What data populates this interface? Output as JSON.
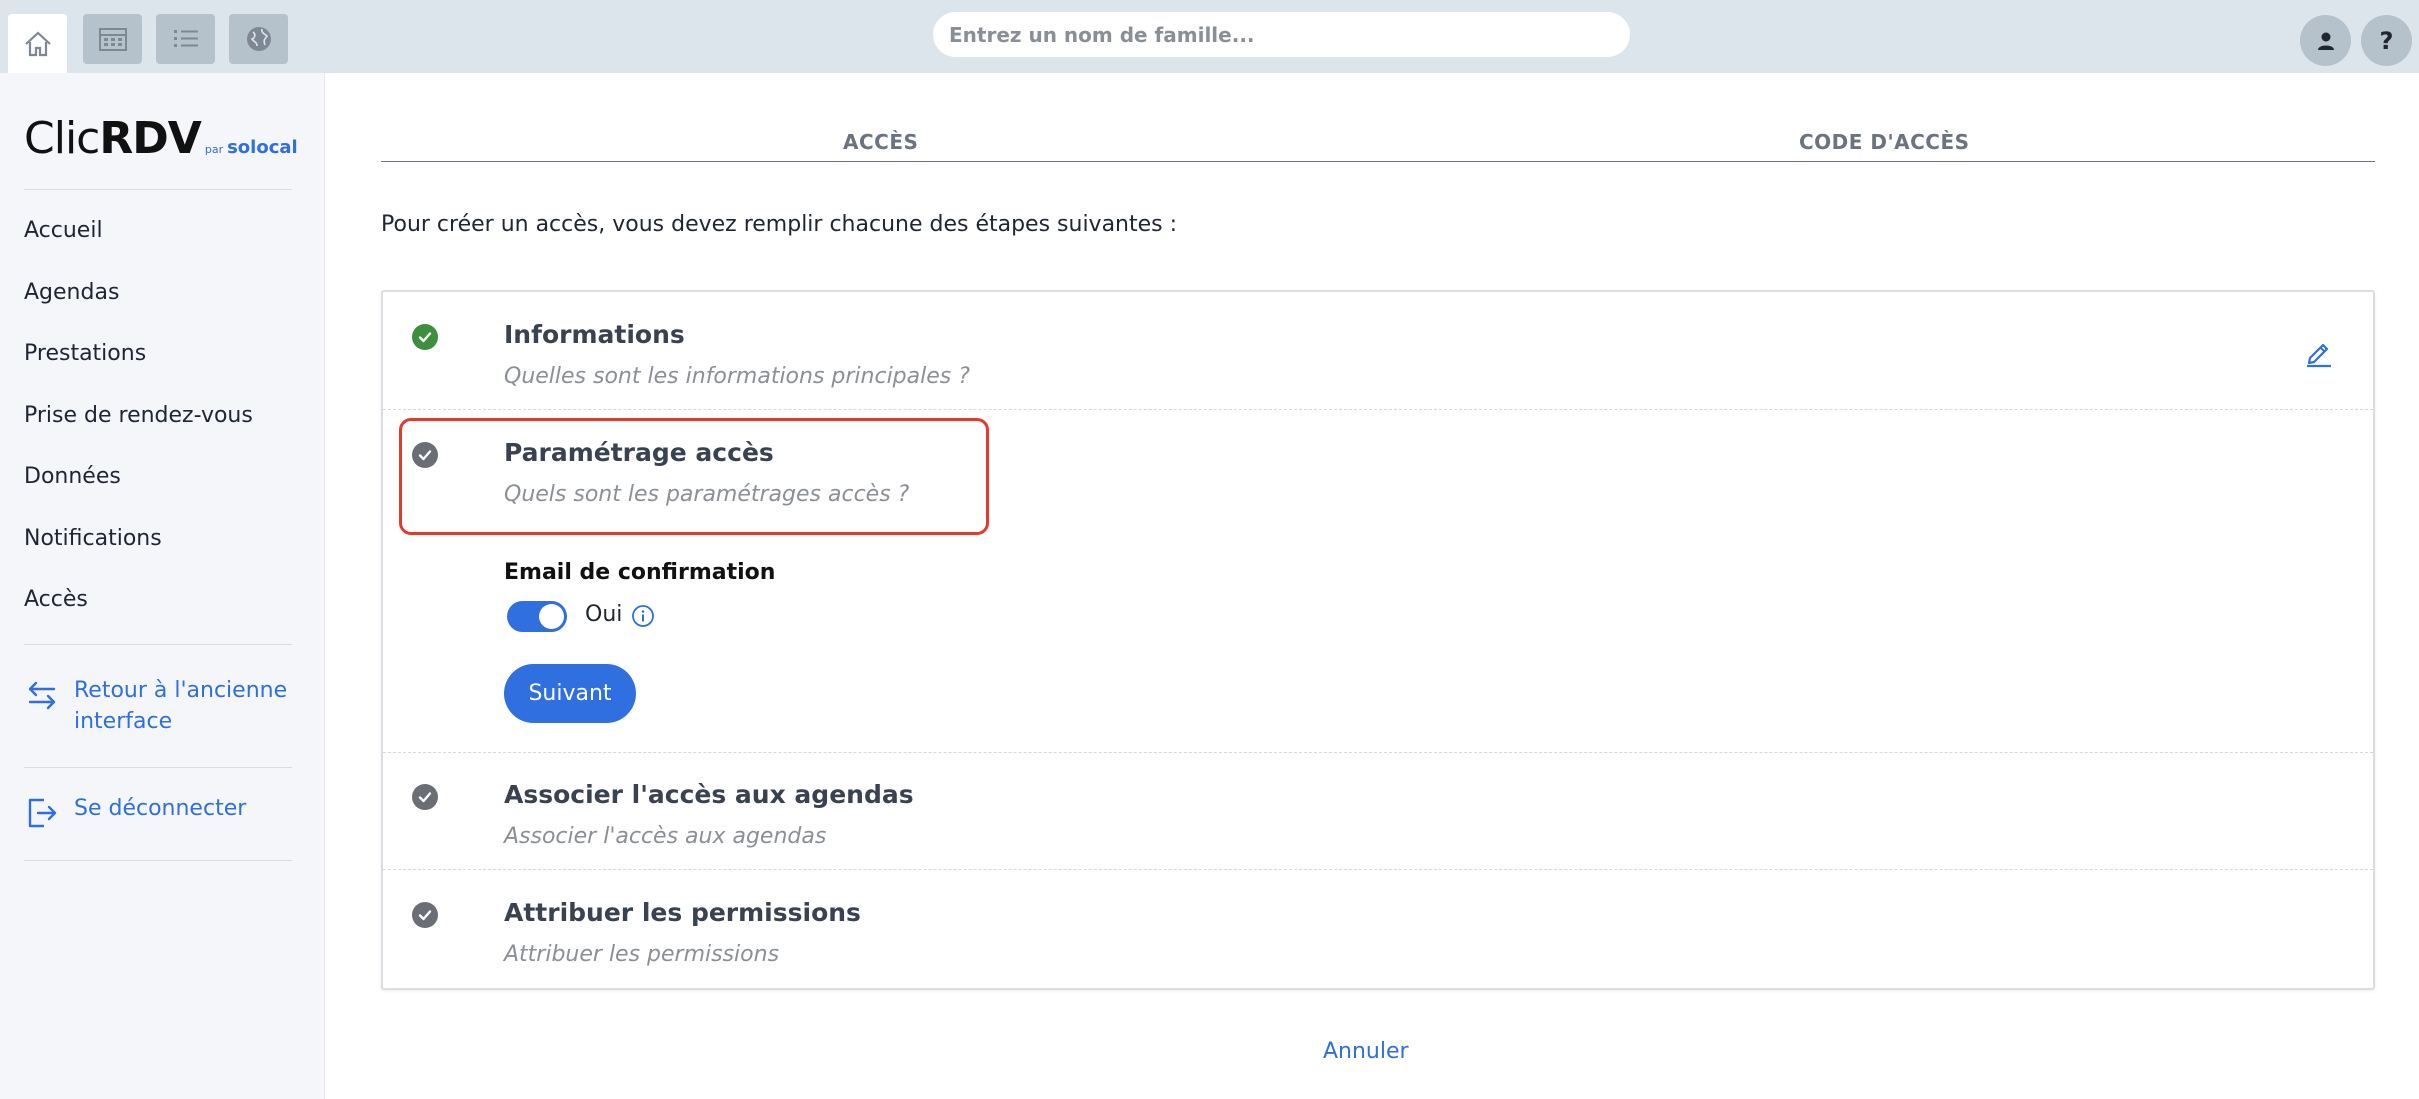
{
  "topbar": {
    "search_placeholder": "Entrez un nom de famille...",
    "help_label": "?"
  },
  "sidebar": {
    "logo": {
      "clic": "Clic",
      "rdv": "RDV",
      "par": "par",
      "brand": "solocal"
    },
    "items": [
      {
        "label": "Accueil"
      },
      {
        "label": "Agendas"
      },
      {
        "label": "Prestations"
      },
      {
        "label": "Prise de rendez-vous"
      },
      {
        "label": "Données"
      },
      {
        "label": "Notifications"
      },
      {
        "label": "Accès"
      }
    ],
    "back_link": "Retour à l'ancienne interface",
    "logout": "Se déconnecter"
  },
  "tabs": [
    {
      "label": "ACCÈS"
    },
    {
      "label": "CODE D'ACCÈS"
    }
  ],
  "intro": "Pour créer un accès, vous devez remplir chacune des étapes suivantes :",
  "steps": [
    {
      "title": "Informations",
      "subtitle": "Quelles sont les informations principales ?",
      "status": "done"
    },
    {
      "title": "Paramétrage accès",
      "subtitle": "Quels sont les paramétrages accès ?",
      "status": "current"
    },
    {
      "title": "Associer l'accès aux agendas",
      "subtitle": "Associer l'accès aux agendas",
      "status": "pending"
    },
    {
      "title": "Attribuer les permissions",
      "subtitle": "Attribuer les permissions",
      "status": "pending"
    }
  ],
  "form": {
    "email_label": "Email de confirmation",
    "toggle_value": "Oui",
    "toggle_on": true,
    "next_button": "Suivant"
  },
  "cancel": "Annuler",
  "colors": {
    "accent": "#2f6fe0",
    "done": "#3c8f3c",
    "pending": "#6b6e75",
    "highlight": "#e23b2b"
  }
}
